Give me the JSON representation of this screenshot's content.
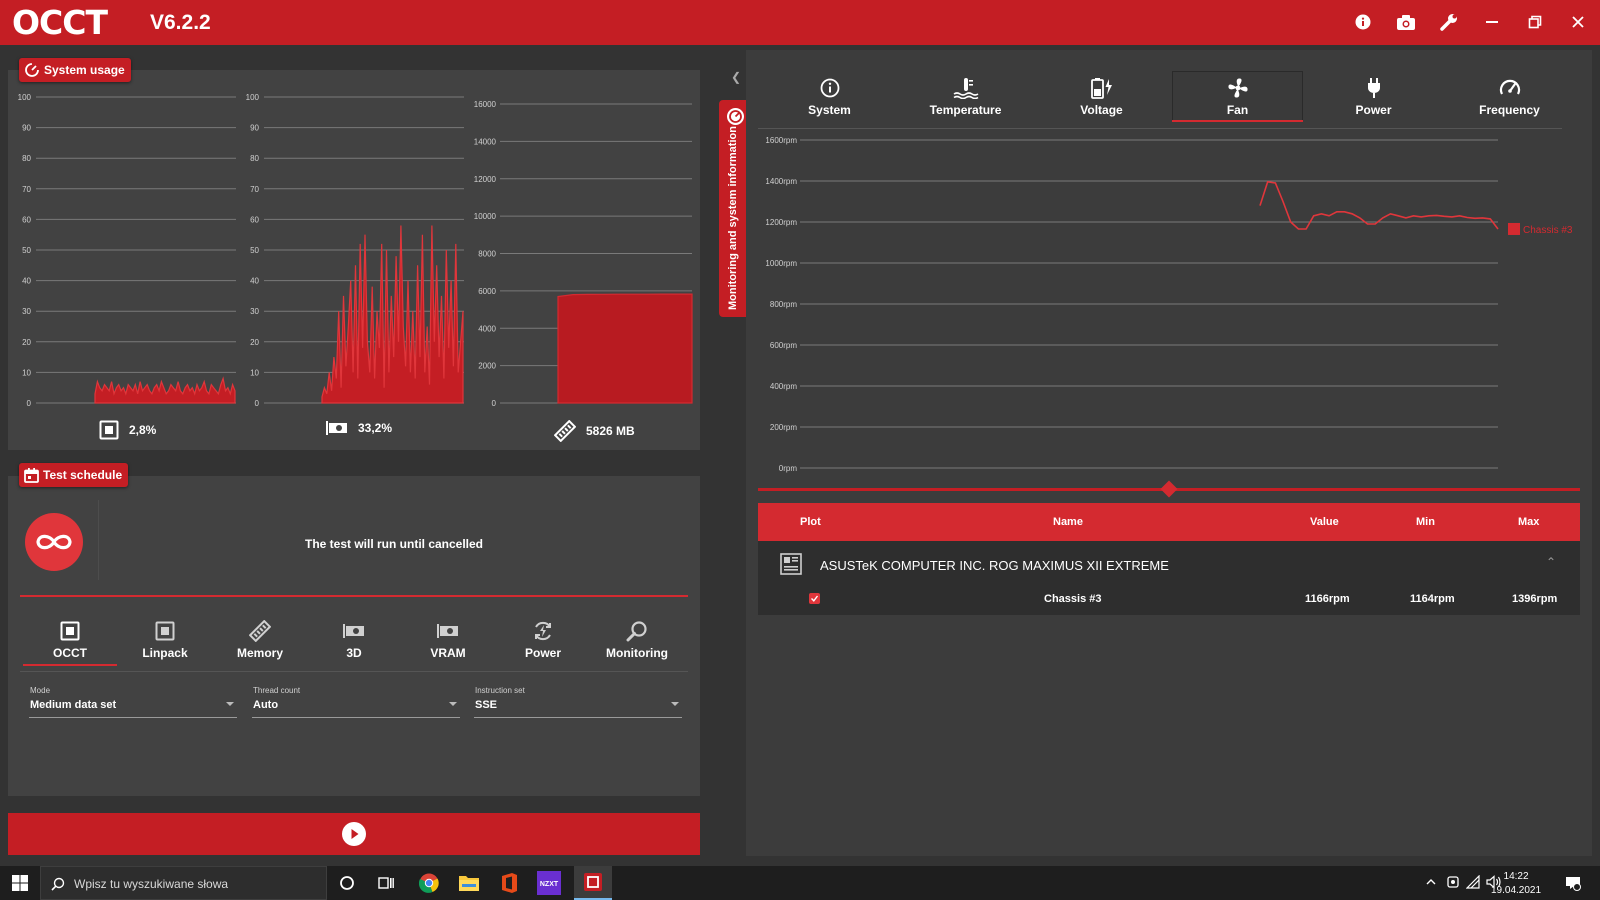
{
  "app": {
    "name": "OCCT",
    "version": "V6.2.2"
  },
  "system_usage": {
    "label": "System usage",
    "cpu": {
      "y_ticks": [
        "100",
        "90",
        "80",
        "70",
        "60",
        "50",
        "40",
        "30",
        "20",
        "10",
        "0"
      ],
      "readout": "2,8%"
    },
    "gpu": {
      "y_ticks": [
        "100",
        "90",
        "80",
        "70",
        "60",
        "50",
        "40",
        "30",
        "20",
        "10",
        "0"
      ],
      "readout": "33,2%"
    },
    "ram": {
      "y_ticks": [
        "16000",
        "14000",
        "12000",
        "10000",
        "8000",
        "6000",
        "4000",
        "2000",
        "0"
      ],
      "readout": "5826 MB"
    }
  },
  "test_schedule": {
    "label": "Test schedule",
    "message": "The test will run until cancelled",
    "tabs": [
      "OCCT",
      "Linpack",
      "Memory",
      "3D",
      "VRAM",
      "Power",
      "Monitoring"
    ],
    "active_tab": "OCCT",
    "fields": {
      "mode": {
        "label": "Mode",
        "value": "Medium data set"
      },
      "thread_count": {
        "label": "Thread count",
        "value": "Auto"
      },
      "instruction_set": {
        "label": "Instruction set",
        "value": "SSE"
      }
    }
  },
  "side_tab": {
    "label": "Monitoring and system information"
  },
  "monitoring": {
    "tabs": [
      "System",
      "Temperature",
      "Voltage",
      "Fan",
      "Power",
      "Frequency"
    ],
    "active_tab": "Fan",
    "series_label": "Chassis #3",
    "table": {
      "columns": [
        "Plot",
        "Name",
        "Value",
        "Min",
        "Max"
      ],
      "device": "ASUSTeK COMPUTER INC. ROG MAXIMUS XII EXTREME",
      "rows": [
        {
          "name": "Chassis #3",
          "value": "1166rpm",
          "min": "1164rpm",
          "max": "1396rpm"
        }
      ]
    }
  },
  "chart_data": [
    {
      "type": "area",
      "series": [
        {
          "values": [
            3,
            7,
            5,
            4,
            6,
            5,
            4,
            7,
            3,
            5,
            6,
            4,
            5,
            3,
            6,
            5,
            4,
            6,
            3,
            7,
            4,
            5,
            6,
            4,
            3,
            5,
            6,
            4,
            7,
            5,
            3,
            4,
            6,
            5,
            4,
            7,
            4,
            3,
            5,
            6,
            4,
            5,
            3,
            6,
            4,
            5,
            7,
            4,
            3,
            6,
            5,
            4,
            3,
            6,
            8,
            4,
            5,
            3,
            6,
            4
          ]
        }
      ],
      "ylim": [
        0,
        100
      ],
      "y_ticks": [
        0,
        10,
        20,
        30,
        40,
        50,
        60,
        70,
        80,
        90,
        100
      ]
    },
    {
      "type": "area",
      "series": [
        {
          "values": [
            2,
            5,
            3,
            10,
            4,
            15,
            8,
            30,
            5,
            35,
            12,
            25,
            40,
            10,
            45,
            8,
            52,
            18,
            55,
            20,
            10,
            38,
            8,
            30,
            18,
            52,
            5,
            50,
            10,
            35,
            15,
            48,
            20,
            58,
            25,
            12,
            40,
            10,
            30,
            8,
            45,
            15,
            55,
            10,
            25,
            6,
            58,
            20,
            45,
            15,
            35,
            8,
            50,
            18,
            40,
            12,
            52,
            10,
            20,
            30
          ]
        }
      ],
      "ylim": [
        0,
        100
      ],
      "y_ticks": [
        0,
        10,
        20,
        30,
        40,
        50,
        60,
        70,
        80,
        90,
        100
      ]
    },
    {
      "type": "area",
      "series": [
        {
          "values": [
            5700,
            5800,
            5810,
            5815,
            5820,
            5822,
            5824,
            5826,
            5826,
            5826
          ]
        }
      ],
      "ylim": [
        0,
        16000
      ],
      "y_ticks": [
        0,
        2000,
        4000,
        6000,
        8000,
        10000,
        12000,
        14000,
        16000
      ]
    },
    {
      "type": "line",
      "series": [
        {
          "name": "Chassis #3",
          "values": [
            1280,
            1396,
            1390,
            1300,
            1200,
            1166,
            1166,
            1230,
            1240,
            1230,
            1250,
            1250,
            1240,
            1220,
            1190,
            1190,
            1220,
            1240,
            1230,
            1220,
            1230,
            1225,
            1230,
            1232,
            1228,
            1225,
            1230,
            1222,
            1218,
            1220,
            1215,
            1166
          ]
        }
      ],
      "ylim": [
        0,
        1600
      ],
      "y_ticks": [
        "0rpm",
        "200rpm",
        "400rpm",
        "600rpm",
        "800rpm",
        "1000rpm",
        "1200rpm",
        "1400rpm",
        "1600rpm"
      ]
    }
  ],
  "taskbar": {
    "search_placeholder": "Wpisz tu wyszukiwane słowa",
    "time": "14:22",
    "date": "19.04.2021"
  },
  "colors": {
    "accent": "#c41e24",
    "accent_light": "#e0363b",
    "panel": "#424242",
    "background": "#333333"
  }
}
